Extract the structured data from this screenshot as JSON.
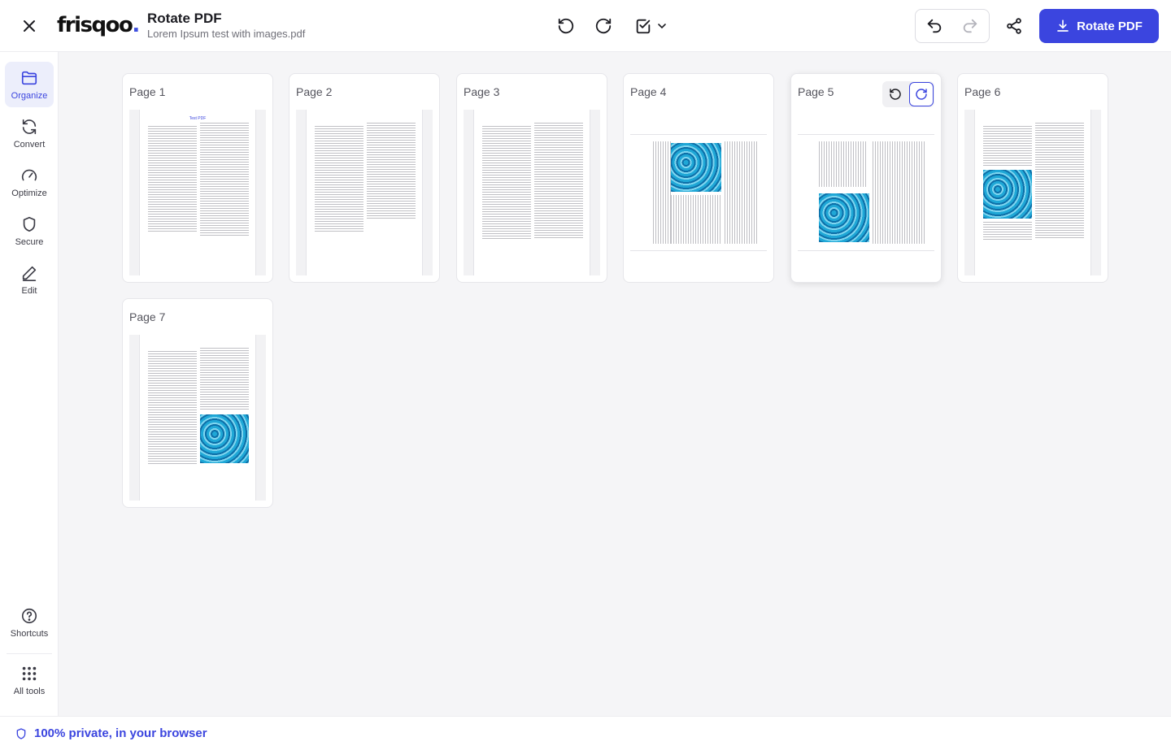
{
  "header": {
    "logo_text": "frisqoo.",
    "title": "Rotate PDF",
    "filename": "Lorem Ipsum test with images.pdf",
    "primary_button": "Rotate PDF"
  },
  "sidebar": {
    "items": [
      {
        "label": "Organize",
        "icon": "folder-icon",
        "active": true
      },
      {
        "label": "Convert",
        "icon": "convert-icon"
      },
      {
        "label": "Optimize",
        "icon": "gauge-icon"
      },
      {
        "label": "Secure",
        "icon": "shield-icon"
      },
      {
        "label": "Edit",
        "icon": "pencil-icon"
      }
    ],
    "bottom": [
      {
        "label": "Shortcuts",
        "icon": "help-circle-icon"
      },
      {
        "label": "All tools",
        "icon": "grid-icon"
      }
    ]
  },
  "pages": [
    {
      "label": "Page 1",
      "orientation": "portrait",
      "title_text": "Test PDF"
    },
    {
      "label": "Page 2",
      "orientation": "portrait"
    },
    {
      "label": "Page 3",
      "orientation": "portrait"
    },
    {
      "label": "Page 4",
      "orientation": "landscape"
    },
    {
      "label": "Page 5",
      "orientation": "landscape"
    },
    {
      "label": "Page 6",
      "orientation": "portrait"
    },
    {
      "label": "Page 7",
      "orientation": "portrait"
    }
  ],
  "footer": {
    "privacy_text": "100% private, in your browser"
  },
  "colors": {
    "accent": "#3b45df",
    "image_blue": "#1fa7d6"
  }
}
